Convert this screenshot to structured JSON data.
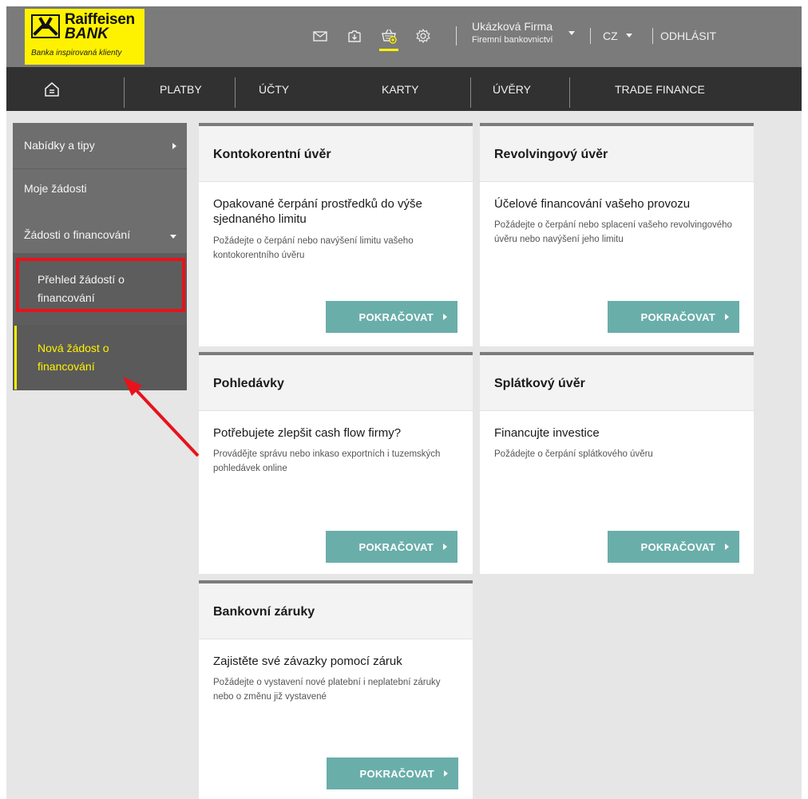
{
  "brand": {
    "name_line1": "Raiffeisen",
    "name_line2": "BANK",
    "tagline": "Banka inspirovaná klienty",
    "color": "#fff200"
  },
  "header": {
    "icons": [
      "mail-icon",
      "download-icon",
      "basket-add-icon",
      "settings-icon"
    ],
    "company_name": "Ukázková Firma",
    "company_sub": "Firemní bankovnictví",
    "language": "CZ",
    "logout_label": "ODHLÁSIT"
  },
  "nav": {
    "home_icon": "home-icon",
    "items": [
      "PLATBY",
      "ÚČTY",
      "KARTY",
      "ÚVĚRY",
      "TRADE FINANCE"
    ]
  },
  "sidebar": {
    "items": [
      {
        "label": "Nabídky a tipy",
        "icon": "chevron-right-icon"
      },
      {
        "label": "Moje žádosti"
      },
      {
        "label": "Žádosti o financování",
        "icon": "chevron-down-icon"
      }
    ],
    "subitems": [
      {
        "line1": "Přehled žádostí o",
        "line2": "financování",
        "highlighted": true
      },
      {
        "line1": "Nová žádost o",
        "line2": "financování",
        "active": true
      }
    ],
    "active_color": "#fff200",
    "highlight_color": "#e8121b"
  },
  "cards": [
    {
      "title": "Kontokorentní úvěr",
      "subtitle": "Opakované čerpání prostředků do výše sjednaného limitu",
      "description": "Požádejte o čerpání nebo navýšení limitu vašeho kontokorentního úvěru",
      "button": "POKRAČOVAT"
    },
    {
      "title": "Revolvingový úvěr",
      "subtitle": "Účelové financování vašeho provozu",
      "description": "Požádejte o čerpání nebo splacení vašeho revolvingového úvěru nebo navýšení jeho limitu",
      "button": "POKRAČOVAT"
    },
    {
      "title": "Pohledávky",
      "subtitle": "Potřebujete zlepšit cash flow firmy?",
      "description": "Provádějte správu nebo inkaso exportních i tuzemských pohledávek online",
      "button": "POKRAČOVAT"
    },
    {
      "title": "Splátkový úvěr",
      "subtitle": "Financujte investice",
      "description": "Požádejte o čerpání splátkového úvěru",
      "button": "POKRAČOVAT"
    },
    {
      "title": "Bankovní záruky",
      "subtitle": "Zajistěte své závazky pomocí záruk",
      "description": "Požádejte o vystavení nové platební i neplatební záruky nebo o změnu již vystavené",
      "button": "POKRAČOVAT"
    }
  ],
  "annotation": {
    "arrow_color": "#e8121b"
  },
  "colors": {
    "header": "#7b7b7b",
    "nav": "#313131",
    "sidebar": "#6e6e6e",
    "button": "#6aaeaa",
    "background": "#e6e6e6"
  }
}
